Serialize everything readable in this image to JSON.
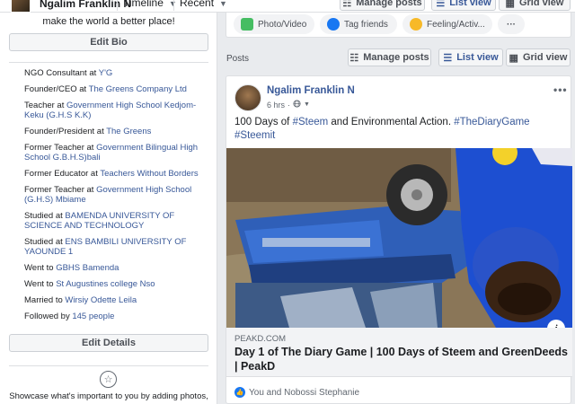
{
  "topbar": {
    "name": "Ngalim Franklin N",
    "timeline_label": "Timeline",
    "recent_label": "Recent",
    "manage_posts": "Manage posts",
    "list_view": "List view",
    "grid_view": "Grid view"
  },
  "intro": {
    "bio": "make the world a better place!",
    "edit_bio": "Edit Bio",
    "items": [
      {
        "prefix": "NGO Consultant at ",
        "link": "Y'G"
      },
      {
        "prefix": "Founder/CEO at ",
        "link": "The Greens Company Ltd"
      },
      {
        "prefix": "Teacher at ",
        "link": "Government High School Kedjom-Keku (G.H.S K.K)"
      },
      {
        "prefix": "Founder/President at ",
        "link": "The Greens"
      },
      {
        "prefix": "Former Teacher at ",
        "link": "Government Bilingual High School G.B.H.S)bali"
      },
      {
        "prefix": "Former Educator at ",
        "link": "Teachers Without Borders"
      },
      {
        "prefix": "Former Teacher at ",
        "link": "Government High School (G.H.S) Mbiame"
      },
      {
        "prefix": "Studied at ",
        "link": "BAMENDA UNIVERSITY OF SCIENCE AND TECHNOLOGY"
      },
      {
        "prefix": "Studied at ",
        "link": "ENS BAMBILI UNIVERSITY OF YAOUNDE 1"
      },
      {
        "prefix": "Went to ",
        "link": "GBHS Bamenda"
      },
      {
        "prefix": "Went to ",
        "link": "St Augustines college Nso"
      },
      {
        "prefix": "Married to ",
        "link": "Wirsiy Odette Leila"
      },
      {
        "prefix": "Followed by ",
        "link": "145 people"
      }
    ],
    "edit_details": "Edit Details",
    "showcase_text": "Showcase what's important to you by adding photos,"
  },
  "composer": {
    "photo_video": "Photo/Video",
    "tag_friends": "Tag friends",
    "feeling": "Feeling/Activ...",
    "more": "···"
  },
  "posts": {
    "label": "Posts",
    "manage_posts": "Manage posts",
    "list_view": "List view",
    "grid_view": "Grid view"
  },
  "post": {
    "author": "Ngalim Franklin N",
    "time": "6 hrs",
    "privacy_icon": "globe-icon",
    "menu": "•••",
    "text_plain": "100 Days of ",
    "tag_steem": "#Steem",
    "text_mid": " and Environmental Action. ",
    "tag_diary": "#TheDiaryGame",
    "tag_steemit": "#Steemit",
    "link_domain": "PEAKD.COM",
    "link_title": "Day 1 of The Diary Game | 100 Days of Steem and GreenDeeds | PeakD",
    "likes": "You and Nobossi Stephanie"
  },
  "colors": {
    "accent": "#385898",
    "background": "#e9ebee",
    "like_blue": "#1877f2"
  }
}
